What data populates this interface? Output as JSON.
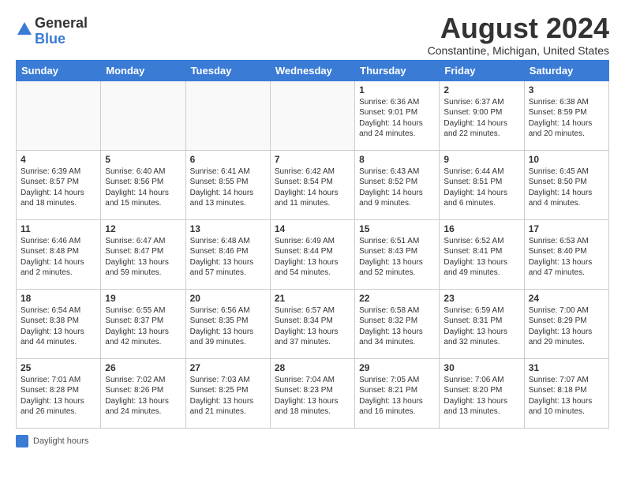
{
  "header": {
    "logo_general": "General",
    "logo_blue": "Blue",
    "month_title": "August 2024",
    "location": "Constantine, Michigan, United States"
  },
  "days_of_week": [
    "Sunday",
    "Monday",
    "Tuesday",
    "Wednesday",
    "Thursday",
    "Friday",
    "Saturday"
  ],
  "weeks": [
    [
      {
        "date": "",
        "sunrise": "",
        "sunset": "",
        "daylight": ""
      },
      {
        "date": "",
        "sunrise": "",
        "sunset": "",
        "daylight": ""
      },
      {
        "date": "",
        "sunrise": "",
        "sunset": "",
        "daylight": ""
      },
      {
        "date": "",
        "sunrise": "",
        "sunset": "",
        "daylight": ""
      },
      {
        "date": "1",
        "sunrise": "Sunrise: 6:36 AM",
        "sunset": "Sunset: 9:01 PM",
        "daylight": "Daylight: 14 hours and 24 minutes."
      },
      {
        "date": "2",
        "sunrise": "Sunrise: 6:37 AM",
        "sunset": "Sunset: 9:00 PM",
        "daylight": "Daylight: 14 hours and 22 minutes."
      },
      {
        "date": "3",
        "sunrise": "Sunrise: 6:38 AM",
        "sunset": "Sunset: 8:59 PM",
        "daylight": "Daylight: 14 hours and 20 minutes."
      }
    ],
    [
      {
        "date": "4",
        "sunrise": "Sunrise: 6:39 AM",
        "sunset": "Sunset: 8:57 PM",
        "daylight": "Daylight: 14 hours and 18 minutes."
      },
      {
        "date": "5",
        "sunrise": "Sunrise: 6:40 AM",
        "sunset": "Sunset: 8:56 PM",
        "daylight": "Daylight: 14 hours and 15 minutes."
      },
      {
        "date": "6",
        "sunrise": "Sunrise: 6:41 AM",
        "sunset": "Sunset: 8:55 PM",
        "daylight": "Daylight: 14 hours and 13 minutes."
      },
      {
        "date": "7",
        "sunrise": "Sunrise: 6:42 AM",
        "sunset": "Sunset: 8:54 PM",
        "daylight": "Daylight: 14 hours and 11 minutes."
      },
      {
        "date": "8",
        "sunrise": "Sunrise: 6:43 AM",
        "sunset": "Sunset: 8:52 PM",
        "daylight": "Daylight: 14 hours and 9 minutes."
      },
      {
        "date": "9",
        "sunrise": "Sunrise: 6:44 AM",
        "sunset": "Sunset: 8:51 PM",
        "daylight": "Daylight: 14 hours and 6 minutes."
      },
      {
        "date": "10",
        "sunrise": "Sunrise: 6:45 AM",
        "sunset": "Sunset: 8:50 PM",
        "daylight": "Daylight: 14 hours and 4 minutes."
      }
    ],
    [
      {
        "date": "11",
        "sunrise": "Sunrise: 6:46 AM",
        "sunset": "Sunset: 8:48 PM",
        "daylight": "Daylight: 14 hours and 2 minutes."
      },
      {
        "date": "12",
        "sunrise": "Sunrise: 6:47 AM",
        "sunset": "Sunset: 8:47 PM",
        "daylight": "Daylight: 13 hours and 59 minutes."
      },
      {
        "date": "13",
        "sunrise": "Sunrise: 6:48 AM",
        "sunset": "Sunset: 8:46 PM",
        "daylight": "Daylight: 13 hours and 57 minutes."
      },
      {
        "date": "14",
        "sunrise": "Sunrise: 6:49 AM",
        "sunset": "Sunset: 8:44 PM",
        "daylight": "Daylight: 13 hours and 54 minutes."
      },
      {
        "date": "15",
        "sunrise": "Sunrise: 6:51 AM",
        "sunset": "Sunset: 8:43 PM",
        "daylight": "Daylight: 13 hours and 52 minutes."
      },
      {
        "date": "16",
        "sunrise": "Sunrise: 6:52 AM",
        "sunset": "Sunset: 8:41 PM",
        "daylight": "Daylight: 13 hours and 49 minutes."
      },
      {
        "date": "17",
        "sunrise": "Sunrise: 6:53 AM",
        "sunset": "Sunset: 8:40 PM",
        "daylight": "Daylight: 13 hours and 47 minutes."
      }
    ],
    [
      {
        "date": "18",
        "sunrise": "Sunrise: 6:54 AM",
        "sunset": "Sunset: 8:38 PM",
        "daylight": "Daylight: 13 hours and 44 minutes."
      },
      {
        "date": "19",
        "sunrise": "Sunrise: 6:55 AM",
        "sunset": "Sunset: 8:37 PM",
        "daylight": "Daylight: 13 hours and 42 minutes."
      },
      {
        "date": "20",
        "sunrise": "Sunrise: 6:56 AM",
        "sunset": "Sunset: 8:35 PM",
        "daylight": "Daylight: 13 hours and 39 minutes."
      },
      {
        "date": "21",
        "sunrise": "Sunrise: 6:57 AM",
        "sunset": "Sunset: 8:34 PM",
        "daylight": "Daylight: 13 hours and 37 minutes."
      },
      {
        "date": "22",
        "sunrise": "Sunrise: 6:58 AM",
        "sunset": "Sunset: 8:32 PM",
        "daylight": "Daylight: 13 hours and 34 minutes."
      },
      {
        "date": "23",
        "sunrise": "Sunrise: 6:59 AM",
        "sunset": "Sunset: 8:31 PM",
        "daylight": "Daylight: 13 hours and 32 minutes."
      },
      {
        "date": "24",
        "sunrise": "Sunrise: 7:00 AM",
        "sunset": "Sunset: 8:29 PM",
        "daylight": "Daylight: 13 hours and 29 minutes."
      }
    ],
    [
      {
        "date": "25",
        "sunrise": "Sunrise: 7:01 AM",
        "sunset": "Sunset: 8:28 PM",
        "daylight": "Daylight: 13 hours and 26 minutes."
      },
      {
        "date": "26",
        "sunrise": "Sunrise: 7:02 AM",
        "sunset": "Sunset: 8:26 PM",
        "daylight": "Daylight: 13 hours and 24 minutes."
      },
      {
        "date": "27",
        "sunrise": "Sunrise: 7:03 AM",
        "sunset": "Sunset: 8:25 PM",
        "daylight": "Daylight: 13 hours and 21 minutes."
      },
      {
        "date": "28",
        "sunrise": "Sunrise: 7:04 AM",
        "sunset": "Sunset: 8:23 PM",
        "daylight": "Daylight: 13 hours and 18 minutes."
      },
      {
        "date": "29",
        "sunrise": "Sunrise: 7:05 AM",
        "sunset": "Sunset: 8:21 PM",
        "daylight": "Daylight: 13 hours and 16 minutes."
      },
      {
        "date": "30",
        "sunrise": "Sunrise: 7:06 AM",
        "sunset": "Sunset: 8:20 PM",
        "daylight": "Daylight: 13 hours and 13 minutes."
      },
      {
        "date": "31",
        "sunrise": "Sunrise: 7:07 AM",
        "sunset": "Sunset: 8:18 PM",
        "daylight": "Daylight: 13 hours and 10 minutes."
      }
    ]
  ],
  "footer": {
    "daylight_hours_label": "Daylight hours"
  }
}
